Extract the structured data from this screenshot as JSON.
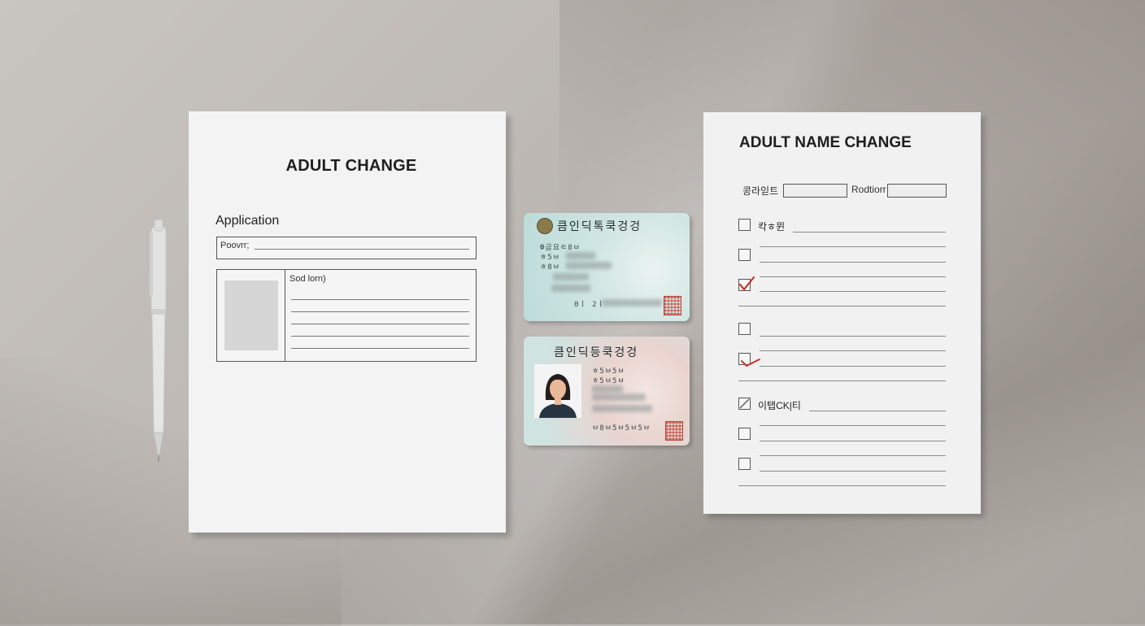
{
  "left_document": {
    "title": "ADULT CHANGE",
    "section_label": "Application",
    "field_label": "Poovrr;",
    "photo_box_label": "Sod lorn)"
  },
  "id_card_1": {
    "header": "큼인딕톡쿡겅겅",
    "line1": "Ф금요ㅌ8ㅂ",
    "line2": "ㅎ5ㅂ",
    "line3": "ㅎ8ㅂ",
    "footer": "0ㅣ 2ㅣ"
  },
  "id_card_2": {
    "header": "큼인딕등쿡겅겅",
    "line1": "ㅎ5ㅂ5ㅂ",
    "line2": "ㅎ5ㅂ5ㅂ",
    "line3": "ㅂ8ㅂ5ㅂ5ㅂ5ㅂ"
  },
  "right_document": {
    "title": "ADULT NAME CHANGE",
    "field1_label": "콩라읻트",
    "field2_label": "Rodtiorr",
    "checkbox1_label": "칵ㅎ뮌",
    "checkbox6_label": "이탭CK|티"
  },
  "colors": {
    "background": "#bdb8b4",
    "paper": "#f3f3f3",
    "check_red": "#c8342c"
  }
}
